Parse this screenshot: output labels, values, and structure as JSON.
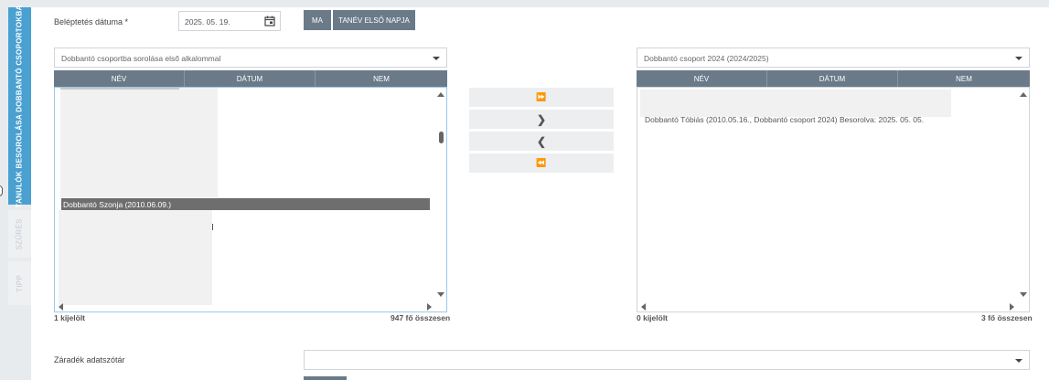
{
  "sidebar": {
    "tab_active": "TANULÓK BESOROLÁSA DOBBANTÓ CSOPORTOKBA",
    "tab_filter": "SZŰRÉS",
    "tab_tip": "TIPP"
  },
  "form": {
    "date_label": "Beléptetés dátuma *",
    "date_value": "2025. 05. 19.",
    "btn_today": "MA",
    "btn_first_day": "TANÉV ELSŐ NAPJA",
    "clause_label": "Záradék adatszótár",
    "clause_value": ""
  },
  "left_panel": {
    "select_value": "Dobbantó csoportba sorolása első alkalommal",
    "columns": [
      "NÉV",
      "DÁTUM",
      "NEM"
    ],
    "selected_row": "Dobbantó Szonja (2010.06.09.)",
    "footer_selected": "1 kijelölt",
    "footer_total": "947 fő összesen"
  },
  "right_panel": {
    "select_value": "Dobbantó csoport 2024 (2024/2025)",
    "columns": [
      "NÉV",
      "DÁTUM",
      "NEM"
    ],
    "row": "Dobbantó Tóbiás (2010.05.16., Dobbantó csoport 2024) Besorolva: 2025. 05. 05.",
    "footer_selected": "0 kijelölt",
    "footer_total": "3 fő összesen"
  },
  "transfer": {
    "move_all_right": "⏩",
    "move_right": "❯",
    "move_left": "❮",
    "move_all_left": "⏪"
  },
  "colors": {
    "accent": "#4aa0d0",
    "header": "#6b7a89",
    "selected_row": "#6e6e6e"
  }
}
